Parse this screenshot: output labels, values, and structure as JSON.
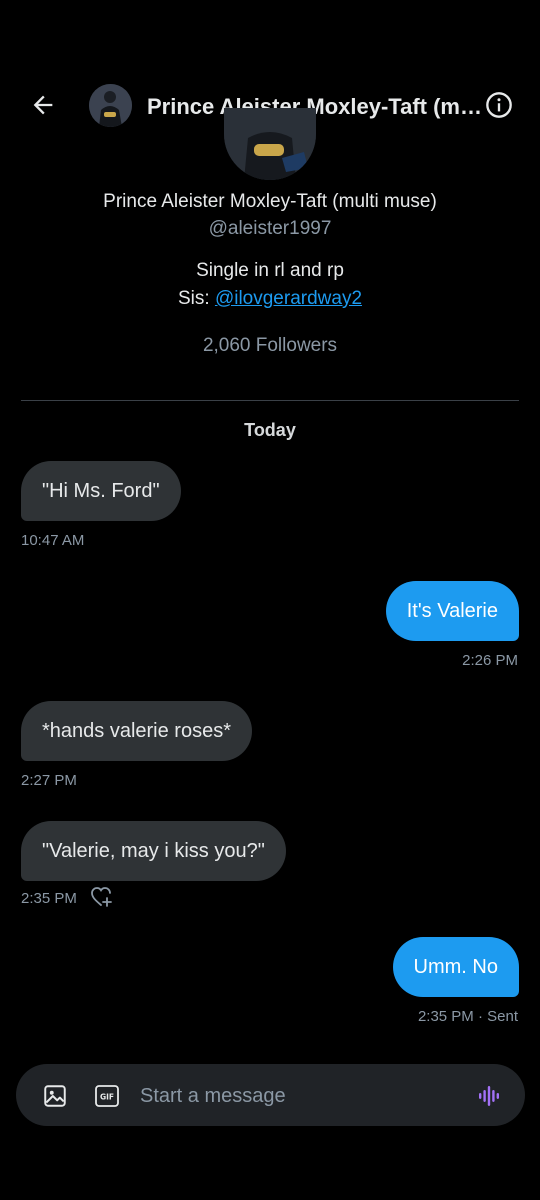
{
  "header": {
    "title": "Prince Aleister Moxley-Taft (multi muse)",
    "back_icon": "arrow-left-icon",
    "info_icon": "info-circle-icon"
  },
  "profile": {
    "name": "Prince Aleister Moxley-Taft (multi muse)",
    "handle": "@aleister1997",
    "bio_line1": "Single in rl and rp",
    "bio_prefix": "Sis: ",
    "bio_link": "@ilovgerardway2",
    "followers": "2,060 Followers"
  },
  "conversation": {
    "date_separator": "Today",
    "messages": [
      {
        "direction": "incoming",
        "text": "\"Hi Ms. Ford\"",
        "time": "10:47 AM"
      },
      {
        "direction": "outgoing",
        "text": "It's Valerie",
        "time": "2:26 PM"
      },
      {
        "direction": "incoming",
        "text": "*hands valerie roses*",
        "time": "2:27 PM"
      },
      {
        "direction": "incoming",
        "text": "\"Valerie, may i kiss you?\"",
        "time": "2:35 PM"
      },
      {
        "direction": "outgoing",
        "text": "Umm. No",
        "time": "2:35 PM · Sent"
      }
    ]
  },
  "composer": {
    "placeholder": "Start a message",
    "gif_label": "GIF",
    "media_icon": "image-icon",
    "gif_icon": "gif-icon",
    "voice_icon": "voice-wave-icon"
  },
  "colors": {
    "background": "#000000",
    "accent": "#1d9bf0",
    "incoming_bubble": "#2f3336",
    "secondary_text": "#8b98a5",
    "voice_icon": "#a371f7"
  }
}
